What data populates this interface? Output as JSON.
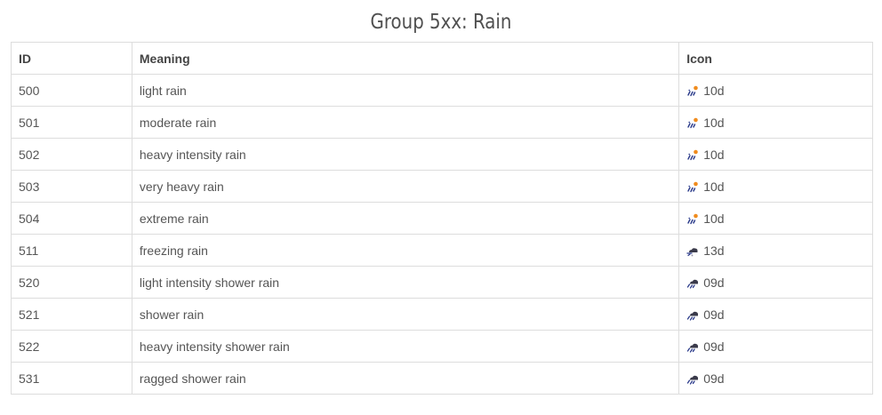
{
  "title": "Group 5xx: Rain",
  "table": {
    "headers": {
      "id": "ID",
      "meaning": "Meaning",
      "icon": "Icon"
    },
    "rows": [
      {
        "id": "500",
        "meaning": "light rain",
        "icon": "10d",
        "icon_name": "sun-rain-icon"
      },
      {
        "id": "501",
        "meaning": "moderate rain",
        "icon": "10d",
        "icon_name": "sun-rain-icon"
      },
      {
        "id": "502",
        "meaning": "heavy intensity rain",
        "icon": "10d",
        "icon_name": "sun-rain-icon"
      },
      {
        "id": "503",
        "meaning": "very heavy rain",
        "icon": "10d",
        "icon_name": "sun-rain-icon"
      },
      {
        "id": "504",
        "meaning": "extreme rain",
        "icon": "10d",
        "icon_name": "sun-rain-icon"
      },
      {
        "id": "511",
        "meaning": "freezing rain",
        "icon": "13d",
        "icon_name": "snow-cloud-icon"
      },
      {
        "id": "520",
        "meaning": "light intensity shower rain",
        "icon": "09d",
        "icon_name": "shower-rain-icon"
      },
      {
        "id": "521",
        "meaning": "shower rain",
        "icon": "09d",
        "icon_name": "shower-rain-icon"
      },
      {
        "id": "522",
        "meaning": "heavy intensity shower rain",
        "icon": "09d",
        "icon_name": "shower-rain-icon"
      },
      {
        "id": "531",
        "meaning": "ragged shower rain",
        "icon": "09d",
        "icon_name": "shower-rain-icon"
      }
    ]
  },
  "colors": {
    "title": "#505050",
    "text": "#555555",
    "border": "#dddddd",
    "rain_drops": "#2a3a8a",
    "sun": "#f08c1e",
    "cloud": "#3a3a4a"
  }
}
